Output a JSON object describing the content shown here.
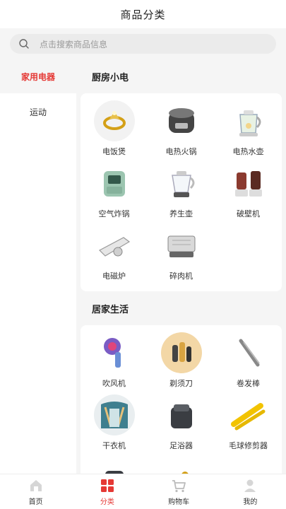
{
  "header": {
    "title": "商品分类"
  },
  "search": {
    "placeholder": "点击搜索商品信息",
    "icon": "search-icon"
  },
  "sidebar": {
    "items": [
      {
        "label": "家用电器",
        "active": true
      },
      {
        "label": "运动",
        "active": false
      }
    ]
  },
  "sections": [
    {
      "title": "厨房小电",
      "items": [
        {
          "label": "电饭煲",
          "icon": "ring-image"
        },
        {
          "label": "电热火锅",
          "icon": "rice-cooker-image"
        },
        {
          "label": "电热水壶",
          "icon": "kettle-image"
        },
        {
          "label": "空气炸锅",
          "icon": "air-fryer-image"
        },
        {
          "label": "养生壶",
          "icon": "health-pot-image"
        },
        {
          "label": "破壁机",
          "icon": "blender-image"
        },
        {
          "label": "电磁炉",
          "icon": "induction-cooker-image"
        },
        {
          "label": "碎肉机",
          "icon": "meat-grinder-image"
        }
      ]
    },
    {
      "title": "居家生活",
      "items": [
        {
          "label": "吹风机",
          "icon": "hair-dryer-image"
        },
        {
          "label": "剃须刀",
          "icon": "shaver-image"
        },
        {
          "label": "卷发棒",
          "icon": "curler-image"
        },
        {
          "label": "干衣机",
          "icon": "clothes-dryer-image"
        },
        {
          "label": "足浴器",
          "icon": "foot-bath-image"
        },
        {
          "label": "毛球修剪器",
          "icon": "lint-remover-image"
        },
        {
          "label": "",
          "icon": "product-image"
        },
        {
          "label": "",
          "icon": "product-image"
        }
      ]
    }
  ],
  "tabbar": {
    "items": [
      {
        "label": "首页",
        "icon": "home-icon",
        "active": false
      },
      {
        "label": "分类",
        "icon": "category-icon",
        "active": true
      },
      {
        "label": "购物车",
        "icon": "cart-icon",
        "active": false
      },
      {
        "label": "我的",
        "icon": "user-icon",
        "active": false
      }
    ]
  },
  "colors": {
    "accent": "#e53935",
    "background": "#f5f5f5"
  }
}
